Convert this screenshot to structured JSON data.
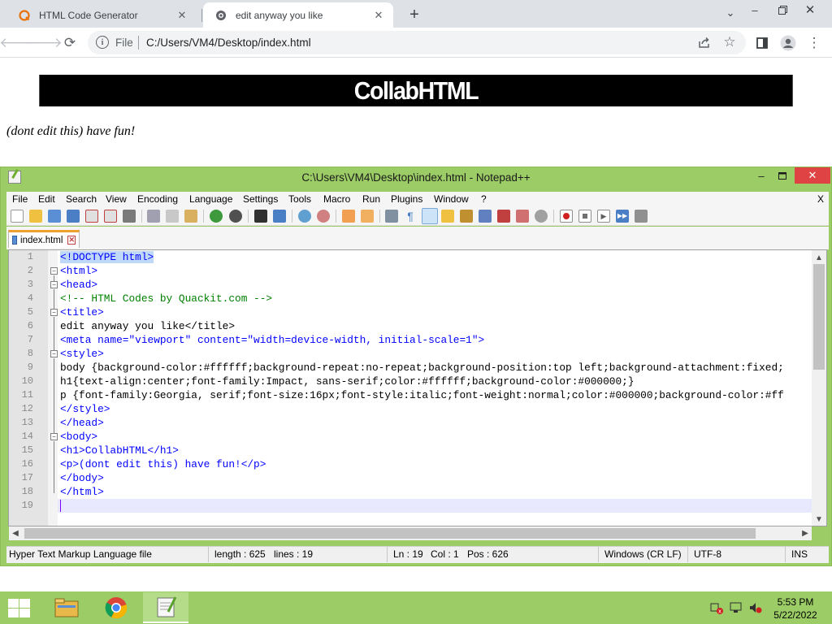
{
  "browser": {
    "tabs": [
      {
        "title": "HTML Code Generator",
        "favicon": "quackit-q-icon",
        "active": false
      },
      {
        "title": "edit anyway you like",
        "favicon": "globe-icon",
        "active": true
      }
    ],
    "omnibox": {
      "scheme_label": "File",
      "url": "C:/Users/VM4/Desktop/index.html"
    }
  },
  "page": {
    "h1": "CollabHTML",
    "p": "(dont edit this) have fun!"
  },
  "notepad": {
    "title": "C:\\Users\\VM4\\Desktop\\index.html - Notepad++",
    "menu": [
      "File",
      "Edit",
      "Search",
      "View",
      "Encoding",
      "Language",
      "Settings",
      "Tools",
      "Macro",
      "Run",
      "Plugins",
      "Window",
      "?"
    ],
    "menu_close": "X",
    "doc_tab": "index.html",
    "code_lines": [
      {
        "n": "1",
        "text": "<!DOCTYPE html>"
      },
      {
        "n": "2",
        "text": "<html>"
      },
      {
        "n": "3",
        "text": "<head>"
      },
      {
        "n": "4",
        "text": "<!-- HTML Codes by Quackit.com -->"
      },
      {
        "n": "5",
        "text": "<title>"
      },
      {
        "n": "6",
        "text": "edit anyway you like</title>"
      },
      {
        "n": "7",
        "text": "<meta name=\"viewport\" content=\"width=device-width, initial-scale=1\">"
      },
      {
        "n": "8",
        "text": "<style>"
      },
      {
        "n": "9",
        "text": "body {background-color:#ffffff;background-repeat:no-repeat;background-position:top left;background-attachment:fixed;"
      },
      {
        "n": "10",
        "text": "h1{text-align:center;font-family:Impact, sans-serif;color:#ffffff;background-color:#000000;}"
      },
      {
        "n": "11",
        "text": "p {font-family:Georgia, serif;font-size:16px;font-style:italic;font-weight:normal;color:#000000;background-color:#ff"
      },
      {
        "n": "12",
        "text": "</style>"
      },
      {
        "n": "13",
        "text": "</head>"
      },
      {
        "n": "14",
        "text": "<body>"
      },
      {
        "n": "15",
        "text": "<h1>CollabHTML</h1>"
      },
      {
        "n": "16",
        "text": "<p>(dont edit this) have fun!</p>"
      },
      {
        "n": "17",
        "text": "</body>"
      },
      {
        "n": "18",
        "text": "</html>"
      },
      {
        "n": "19",
        "text": ""
      }
    ],
    "status": {
      "filetype": "Hyper Text Markup Language file",
      "length": "length : 625",
      "lines": "lines : 19",
      "ln": "Ln : 19",
      "col": "Col : 1",
      "pos": "Pos : 626",
      "eol": "Windows (CR LF)",
      "encoding": "UTF-8",
      "mode": "INS"
    }
  },
  "taskbar": {
    "time": "5:53 PM",
    "date": "5/22/2022"
  },
  "colors": {
    "npp_frame": "#9ccc65",
    "taskbar": "#9ccc65",
    "h1_bg": "#000000",
    "close_red": "#e04343"
  }
}
